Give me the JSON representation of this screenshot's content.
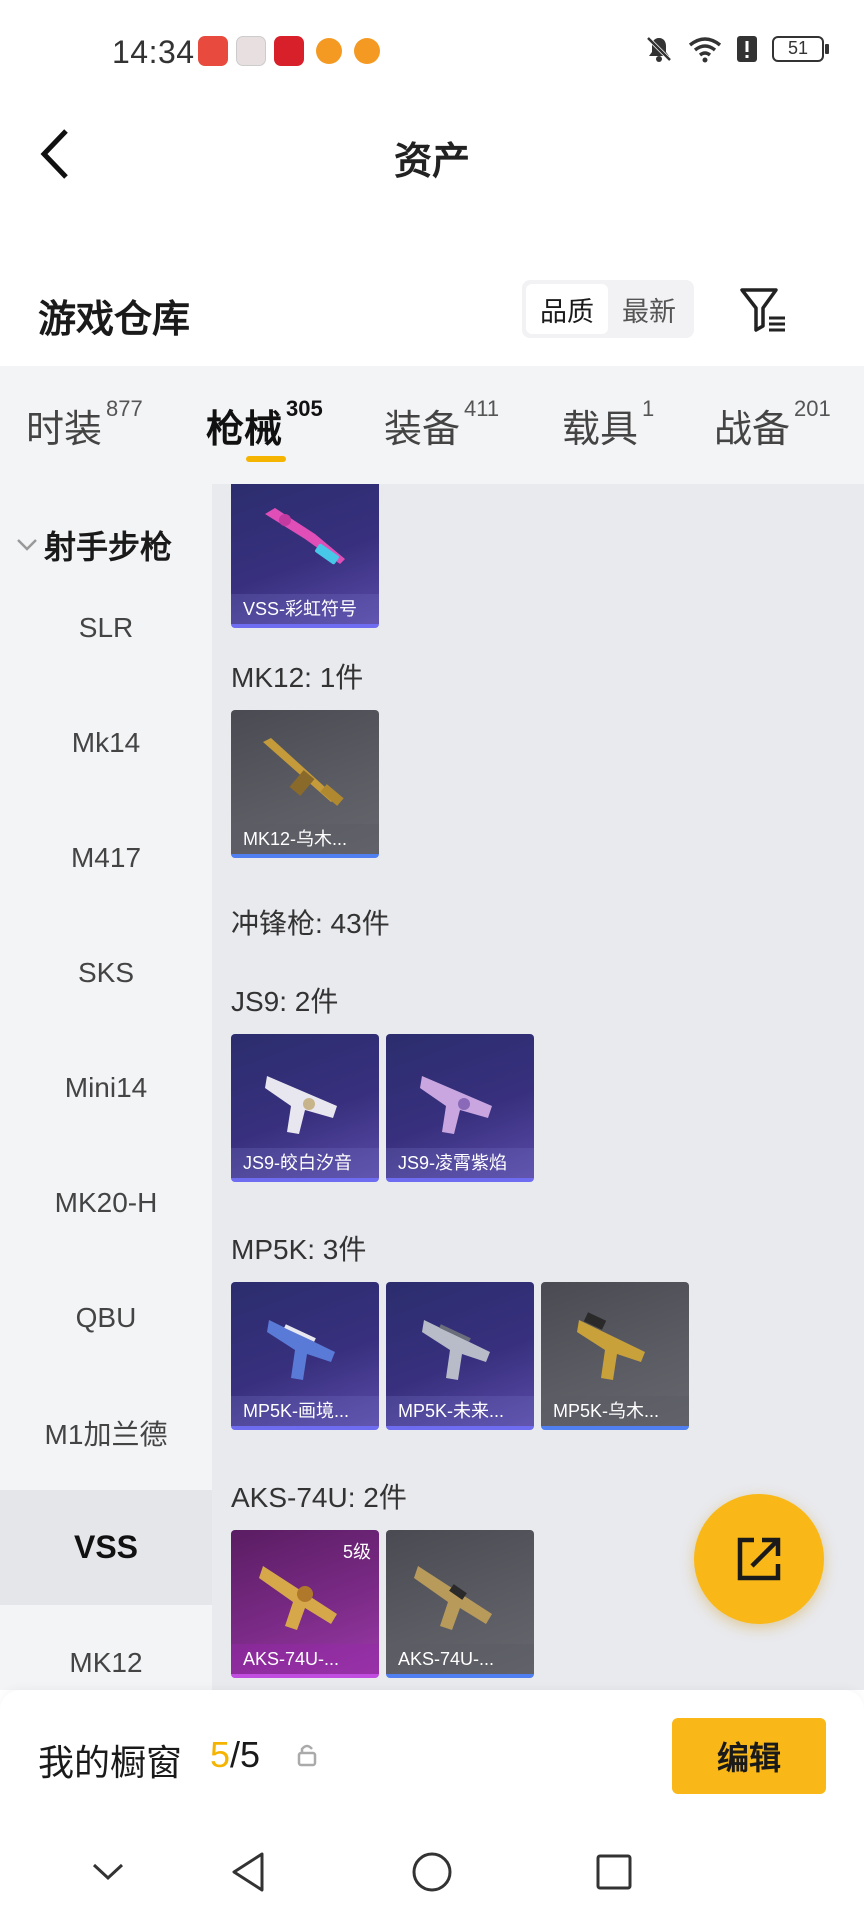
{
  "status_bar": {
    "time": "14:34",
    "battery": "51"
  },
  "header": {
    "title": "资产"
  },
  "warehouse": {
    "title": "游戏仓库",
    "sort_options": [
      "品质",
      "最新"
    ],
    "active_sort": "品质"
  },
  "category_tabs": [
    {
      "label": "时装",
      "count": "877"
    },
    {
      "label": "枪械",
      "count": "305"
    },
    {
      "label": "装备",
      "count": "411"
    },
    {
      "label": "载具",
      "count": "1"
    },
    {
      "label": "战备",
      "count": "201"
    }
  ],
  "active_tab": "枪械",
  "sub_nav": {
    "group": "射手步枪",
    "items": [
      "SLR",
      "Mk14",
      "M417",
      "SKS",
      "Mini14",
      "MK20-H",
      "QBU",
      "M1加兰德",
      "VSS",
      "MK12"
    ],
    "active": "VSS"
  },
  "content": {
    "top_card": {
      "label": "VSS-彩虹符号",
      "color": "#38307e"
    },
    "groups": [
      {
        "title": "MK12: 1件",
        "cards": [
          {
            "label": "MK12-乌木...",
            "style": "grey"
          }
        ]
      },
      {
        "title": "冲锋枪: 43件",
        "cards": []
      },
      {
        "title": "JS9: 2件",
        "cards": [
          {
            "label": "JS9-皎白汐音",
            "style": "blue"
          },
          {
            "label": "JS9-凌霄紫焰",
            "style": "blue"
          }
        ]
      },
      {
        "title": "MP5K: 3件",
        "cards": [
          {
            "label": "MP5K-画境...",
            "style": "blue"
          },
          {
            "label": "MP5K-未来...",
            "style": "blue"
          },
          {
            "label": "MP5K-乌木...",
            "style": "grey"
          }
        ]
      },
      {
        "title": "AKS-74U: 2件",
        "cards": [
          {
            "label": "AKS-74U-...",
            "style": "purple",
            "level": "5级"
          },
          {
            "label": "AKS-74U-...",
            "style": "grey"
          }
        ]
      }
    ]
  },
  "showcase": {
    "title": "我的橱窗",
    "current": "5",
    "separator": "/",
    "total": "5",
    "edit_label": "编辑"
  },
  "colors": {
    "accent": "#f9b817",
    "tab_underline": "#f5b400"
  }
}
